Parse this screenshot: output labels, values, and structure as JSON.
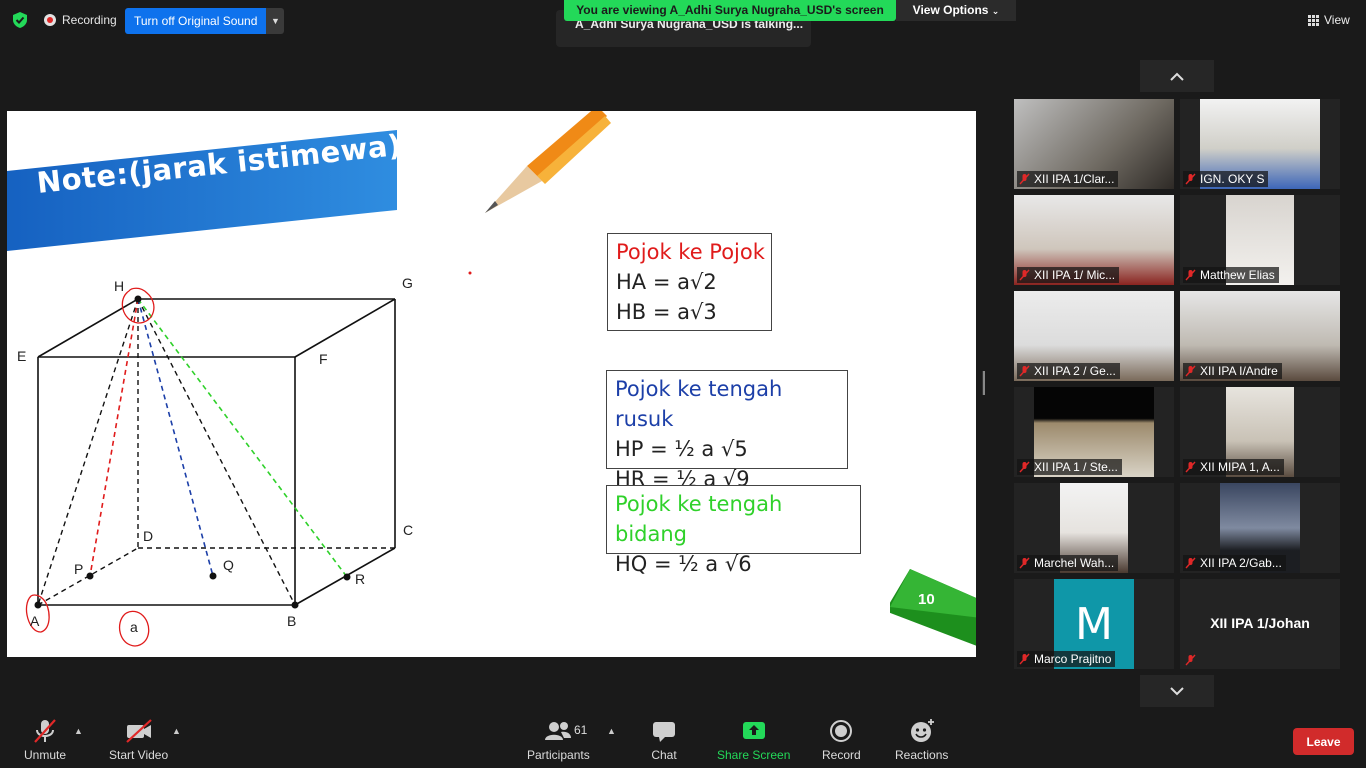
{
  "top_bar": {
    "recording_label": "Recording",
    "original_sound_label": "Turn off Original Sound",
    "viewing_banner": "You are viewing A_Adhi Surya Nugraha_USD's screen",
    "view_options_label": "View Options",
    "talking_label": "A_Adhi Surya Nugraha_USD is talking...",
    "view_label": "View"
  },
  "slide": {
    "title": "Note:(jarak istimewa)",
    "box1": {
      "heading": "Pojok ke Pojok",
      "lines": [
        "HA = a√2",
        "HB = a√3"
      ],
      "heading_color": "#e01b1b"
    },
    "box2": {
      "heading": "Pojok ke tengah rusuk",
      "lines": [
        "HP = ½ a √5",
        "HR = ½ a √9"
      ],
      "heading_color": "#1c3fa8"
    },
    "box3": {
      "heading": "Pojok ke tengah bidang",
      "lines": [
        "HQ = ½ a √6"
      ],
      "heading_color": "#2fd12a"
    },
    "page_number": "10",
    "points": {
      "H": "H",
      "G": "G",
      "E": "E",
      "F": "F",
      "D": "D",
      "C": "C",
      "P": "P",
      "Q": "Q",
      "R": "R",
      "A": "A",
      "B": "B",
      "a": "a"
    }
  },
  "gallery": {
    "participants": [
      {
        "name": "XII IPA 1/Clar...",
        "muted": true
      },
      {
        "name": "IGN. OKY S",
        "muted": true
      },
      {
        "name": "XII IPA 1/ Mic...",
        "muted": true
      },
      {
        "name": "Matthew Elias",
        "muted": true
      },
      {
        "name": "XII IPA 2 / Ge...",
        "muted": true
      },
      {
        "name": "XII IPA I/Andre",
        "muted": true
      },
      {
        "name": "XII IPA 1 / Ste...",
        "muted": true
      },
      {
        "name": "XII MIPA 1, A...",
        "muted": true
      },
      {
        "name": "Marchel Wah...",
        "muted": true
      },
      {
        "name": "XII IPA 2/Gab...",
        "muted": true
      },
      {
        "name": "Marco Prajitno",
        "muted": true,
        "avatar_letter": "M"
      },
      {
        "name": "XII IPA 1/Johan",
        "muted": true,
        "name_only": true
      }
    ]
  },
  "toolbar": {
    "unmute": "Unmute",
    "start_video": "Start Video",
    "participants": "Participants",
    "participants_count": "61",
    "chat": "Chat",
    "share_screen": "Share Screen",
    "record": "Record",
    "reactions": "Reactions",
    "leave": "Leave"
  },
  "colors": {
    "share_green": "#23d959",
    "zoom_blue": "#0e72ed",
    "leave_red": "#d12b2b"
  }
}
